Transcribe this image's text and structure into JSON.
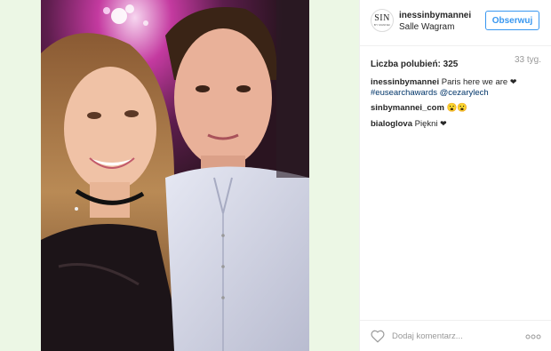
{
  "post": {
    "username": "inessinbymannei",
    "location": "Salle Wagram",
    "avatar_monogram": "SIN",
    "avatar_subtext": "BY MANNEI",
    "follow_label": "Obserwuj",
    "likes_label": "Liczba polubień: 325",
    "time_ago": "33 tyg.",
    "photo_description": "Selfie of a smiling woman with long blonde hair and a black choker and a man in a light shirt at an event"
  },
  "comments": [
    {
      "author": "inessinbymannei",
      "text": " Paris here we are ",
      "heart": "❤",
      "tags": "#eusearchawards @cezarylech"
    },
    {
      "author": "sinbymannei_com",
      "text": " 😮😮"
    },
    {
      "author": "bialoglova",
      "text": " Piękni ",
      "heart": "❤"
    }
  ],
  "footer": {
    "comment_placeholder": "Dodaj komentarz..."
  },
  "colors": {
    "accent": "#3897f0",
    "link": "#003569",
    "page_bg_left": "#ecf7e5"
  },
  "icons": {
    "like": "heart-outline-icon",
    "more": "more-options-icon"
  }
}
